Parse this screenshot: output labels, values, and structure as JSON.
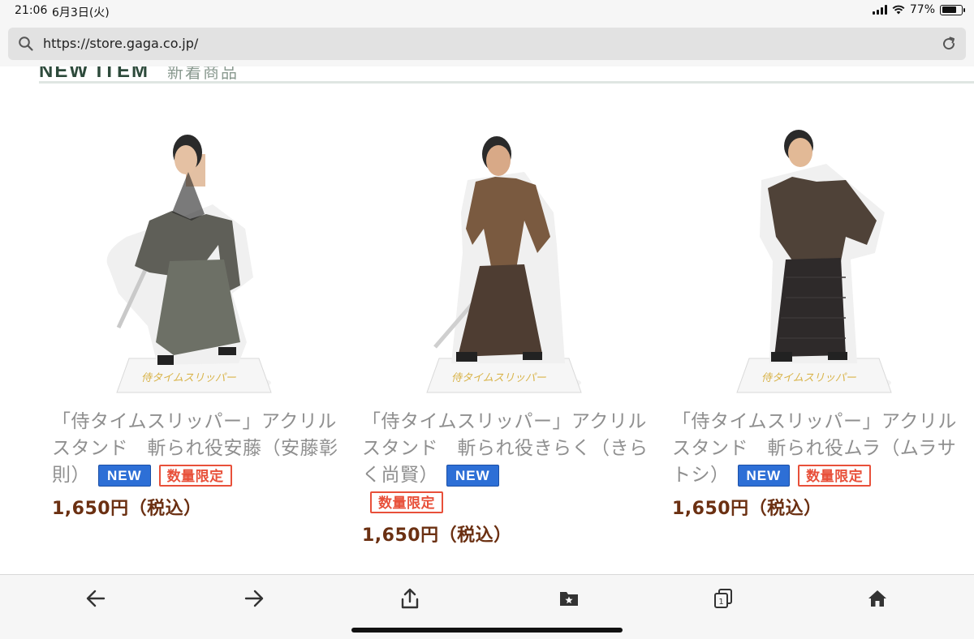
{
  "status_bar": {
    "time": "21:06",
    "date": "6月3日(火)",
    "battery_percent": "77%",
    "battery_level": 0.77
  },
  "browser": {
    "url": "https://store.gaga.co.jp/"
  },
  "section": {
    "title": "NEW ITEM",
    "subtitle": "新着商品"
  },
  "products": [
    {
      "title": "「侍タイムスリッパー」アクリルスタンド　斬られ役安藤（安藤彰則）",
      "badge_new": "NEW",
      "badge_limited": "数量限定",
      "price": "1,650円（税込）",
      "kimono_color": "#5f5f58",
      "hakama_color": "#6d7066"
    },
    {
      "title": "「侍タイムスリッパー」アクリルスタンド　斬られ役きらく（きらく尚賢）",
      "badge_new": "NEW",
      "badge_limited": "数量限定",
      "price": "1,650円（税込）",
      "kimono_color": "#7a5a40",
      "hakama_color": "#4e3d32"
    },
    {
      "title": "「侍タイムスリッパー」アクリルスタンド　斬られ役ムラ（ムラサトシ）",
      "badge_new": "NEW",
      "badge_limited": "数量限定",
      "price": "1,650円（税込）",
      "kimono_color": "#4f4238",
      "hakama_color": "#2e2a2a"
    }
  ],
  "toolbar": {
    "back_icon": "back-arrow-icon",
    "forward_icon": "forward-arrow-icon",
    "share_icon": "share-icon",
    "bookmarks_icon": "bookmark-folder-star-icon",
    "tabs_count": "1",
    "home_icon": "home-icon"
  }
}
